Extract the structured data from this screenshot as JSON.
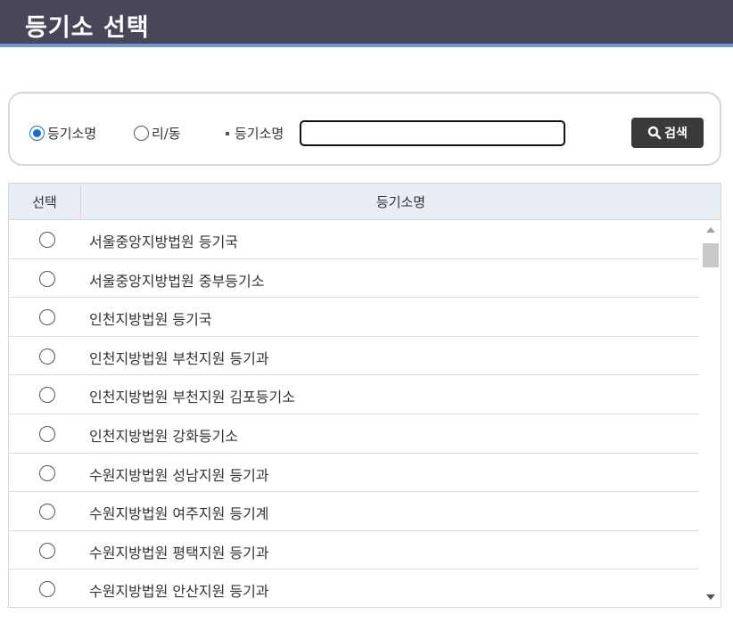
{
  "header": {
    "title": "등기소 선택"
  },
  "search": {
    "radio_options": [
      {
        "label": "등기소명",
        "checked": true
      },
      {
        "label": "리/동",
        "checked": false
      }
    ],
    "field_label": "등기소명",
    "input_value": "",
    "button_label": "검색"
  },
  "table": {
    "columns": [
      "선택",
      "등기소명"
    ],
    "rows": [
      "서울중앙지방법원 등기국",
      "서울중앙지방법원 중부등기소",
      "인천지방법원 등기국",
      "인천지방법원 부천지원 등기과",
      "인천지방법원 부천지원 김포등기소",
      "인천지방법원 강화등기소",
      "수원지방법원 성남지원 등기과",
      "수원지방법원 여주지원 등기계",
      "수원지방법원 평택지원 등기과",
      "수원지방법원 안산지원 등기과"
    ]
  },
  "colors": {
    "header_bg": "#484759",
    "header_accent": "#6b9bd1",
    "radio_checked": "#1a6fd6",
    "button_bg": "#3a3a3a"
  }
}
